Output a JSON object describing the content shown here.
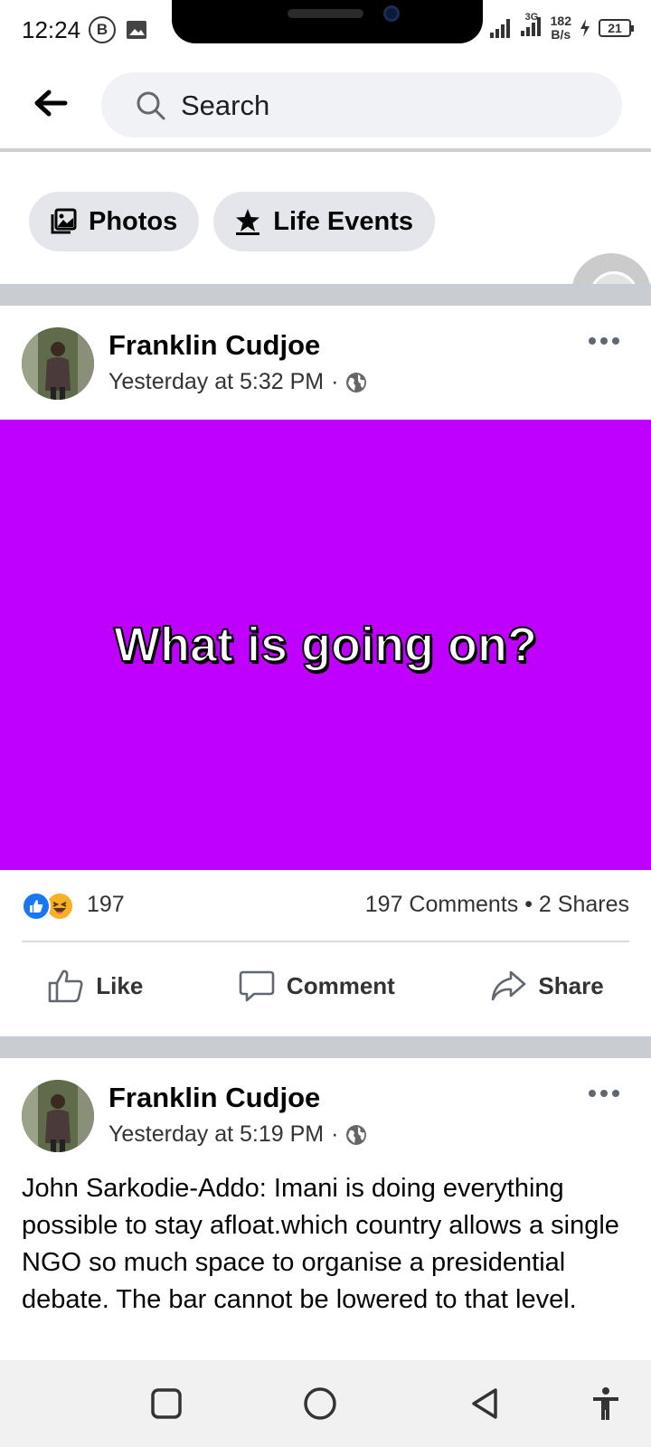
{
  "status_bar": {
    "time": "12:24",
    "badge_letter": "B",
    "network_type": "3G",
    "speed_value": "182",
    "speed_unit": "B/s",
    "battery": "21"
  },
  "search": {
    "placeholder": "Search"
  },
  "filters": [
    {
      "label": "Photos",
      "icon": "photos-icon"
    },
    {
      "label": "Life Events",
      "icon": "star-icon"
    }
  ],
  "posts": [
    {
      "author": "Franklin Cudjoe",
      "timestamp": "Yesterday at 5:32 PM",
      "separator": "·",
      "privacy_icon": "globe-icon",
      "media_text": "What is going on?",
      "media_color": "#c000ff",
      "reaction_count": "197",
      "engagement": "197 Comments • 2 Shares",
      "actions": [
        "Like",
        "Comment",
        "Share"
      ]
    },
    {
      "author": "Franklin Cudjoe",
      "timestamp": "Yesterday at 5:19 PM",
      "separator": "·",
      "privacy_icon": "globe-icon",
      "text": "John Sarkodie-Addo: Imani is doing everything possible to stay afloat.which country allows a single NGO so much space to organise a presidential debate. The bar cannot  be lowered  to that  level."
    }
  ],
  "nav_bar": {
    "buttons": [
      "recent-apps-icon",
      "home-icon",
      "back-triangle-icon",
      "accessibility-icon"
    ]
  },
  "colors": {
    "facebook_blue": "#1877f2",
    "chip_bg": "#e4e6eb",
    "separator": "#c9ccd1"
  }
}
